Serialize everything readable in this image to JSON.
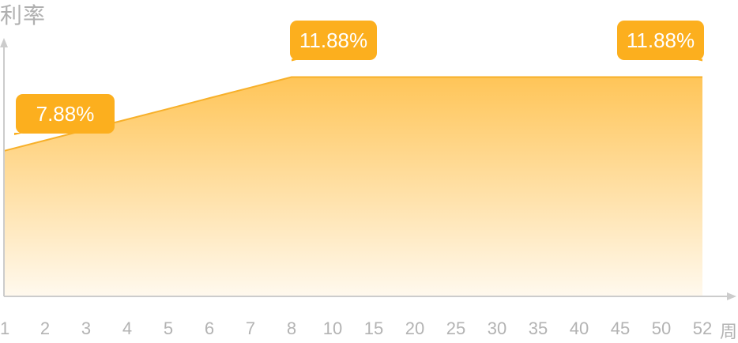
{
  "colors": {
    "line": "#f7b02a",
    "fill_top": "#ffc558",
    "fill_bottom": "#fff9ee",
    "callout_bg": "#fcaf1e",
    "axis": "#cccccc",
    "text": "#b3b3b3"
  },
  "chart_data": {
    "type": "area",
    "ylabel": "利率",
    "x_unit": "周",
    "categories": [
      "1",
      "2",
      "3",
      "4",
      "5",
      "6",
      "7",
      "8",
      "10",
      "15",
      "20",
      "25",
      "30",
      "35",
      "40",
      "45",
      "50",
      "52"
    ],
    "values": [
      7.88,
      8.45,
      9.02,
      9.59,
      10.16,
      10.74,
      11.31,
      11.88,
      11.88,
      11.88,
      11.88,
      11.88,
      11.88,
      11.88,
      11.88,
      11.88,
      11.88,
      11.88
    ],
    "ylim": [
      0,
      14
    ],
    "grid": false,
    "annotations": [
      {
        "category_index": 0,
        "text": "7.88%"
      },
      {
        "category_index": 7,
        "text": "11.88%"
      },
      {
        "category_index": 17,
        "text": "11.88%"
      }
    ]
  }
}
